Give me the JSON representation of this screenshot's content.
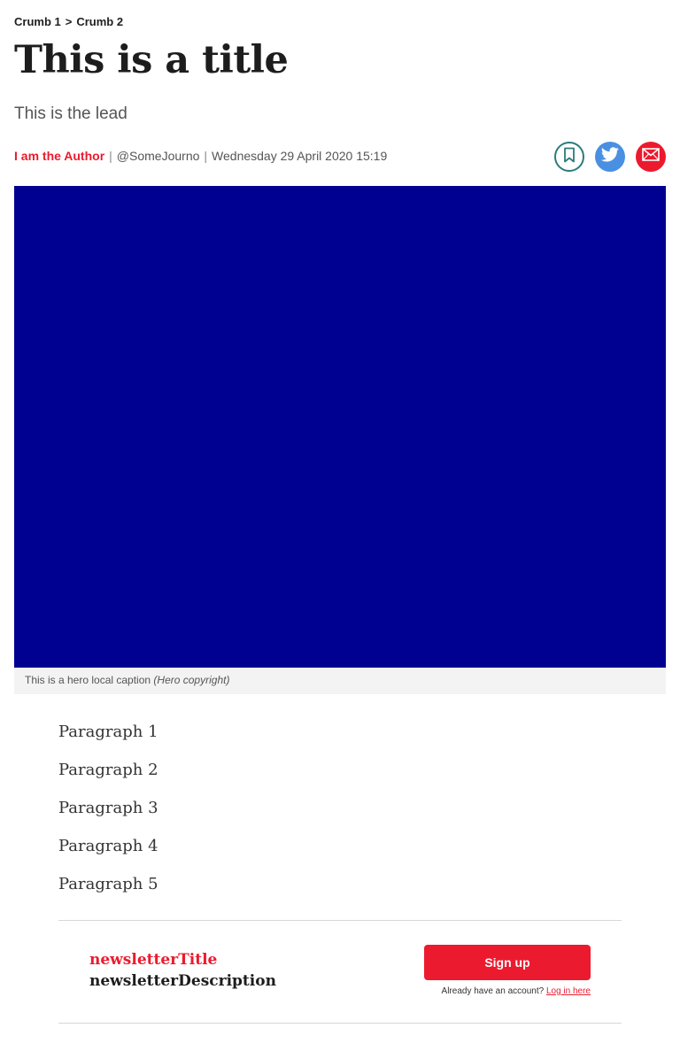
{
  "breadcrumb": {
    "items": [
      "Crumb 1",
      "Crumb 2"
    ],
    "separator": ">"
  },
  "article": {
    "title": "This is a title",
    "lead": "This is the lead",
    "author": "I am the Author",
    "twitter_handle": "@SomeJourno",
    "date": "Wednesday 29 April 2020 15:19",
    "byline_separator": "|"
  },
  "share": {
    "icons": [
      "bookmark-icon",
      "twitter-icon",
      "email-icon"
    ]
  },
  "hero": {
    "color": "#000091",
    "caption": "This is a hero local caption",
    "copyright": "(Hero copyright)"
  },
  "paragraphs": [
    "Paragraph 1",
    "Paragraph 2",
    "Paragraph 3",
    "Paragraph 4",
    "Paragraph 5"
  ],
  "newsletter": {
    "title": "newsletterTitle",
    "description": "newsletterDescription",
    "signup_label": "Sign up",
    "account_prompt": "Already have an account?",
    "login_link": "Log in here"
  },
  "colors": {
    "accent": "#ec1a2e",
    "bookmark_outline": "#2c7b7b",
    "twitter": "#4a90e2"
  }
}
